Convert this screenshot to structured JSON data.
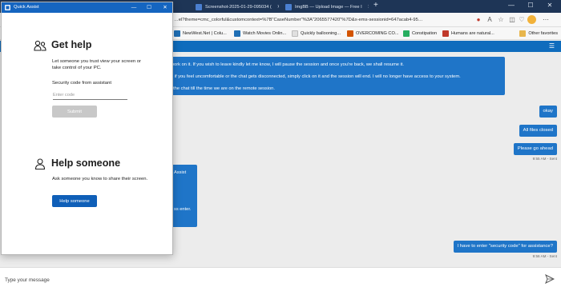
{
  "browser": {
    "tabs": [
      {
        "title": "Screenshot-2025-01-29-095034 ("
      },
      {
        "title": "ImgBB — Upload Image — Free I"
      }
    ],
    "new_tab_symbol": "+",
    "window_controls": {
      "minimize": "—",
      "maximize": "☐",
      "close": "✕"
    },
    "address": "…el?theme=cmc_colorful&customcontext=%7B\"CaseNumber\"%3A\"2065577420\"%7D&x-ems-sessionid=647acab4-95…",
    "favorites": [
      {
        "label": "NewWest.Net | Colu...",
        "color": "#1f6fb5"
      },
      {
        "label": "Watch Movies Onlin...",
        "color": "#1f6fb5"
      },
      {
        "label": "Quickly ballooning...",
        "color": "#e0e0e0"
      },
      {
        "label": "OVERCOMING CO...",
        "color": "#d35400"
      },
      {
        "label": "Constipation",
        "color": "#27ae60"
      },
      {
        "label": "Humans are natural...",
        "color": "#c0392b"
      }
    ],
    "other_favorites": "Other favorites",
    "accent": "#0f6cbd"
  },
  "chat": {
    "agent_block_lines": [
      "work on it. If you wish to leave kindly let me know, I will pause the session and once you're back, we shall resume it.",
      "t, if you feel uncomfortable or the chat gets disconnected, simply click on it and the session will end. I will no longer have access to your system.",
      "t the chat till the time we are on the remote session."
    ],
    "agent_block2_lines": [
      "Assist",
      "ss enter."
    ],
    "user_messages": [
      {
        "text": "okay",
        "stamp": ""
      },
      {
        "text": "All files closed",
        "stamp": ""
      },
      {
        "text": "Please go ahead",
        "stamp": "9:55 AM - Sent"
      },
      {
        "text": "I have to enter \"security code\" for assistance?",
        "stamp": "9:56 AM - Sent"
      }
    ],
    "composer_placeholder": "Type your message"
  },
  "quick_assist": {
    "title": "Quick Assist",
    "get_help": {
      "heading": "Get help",
      "description": "Let someone you trust view your screen or take control of your PC.",
      "field_label": "Security code from assistant",
      "field_placeholder": "Enter code",
      "submit_label": "Submit"
    },
    "help_someone": {
      "heading": "Help someone",
      "description": "Ask someone you know to share their screen.",
      "button_label": "Help someone"
    }
  }
}
